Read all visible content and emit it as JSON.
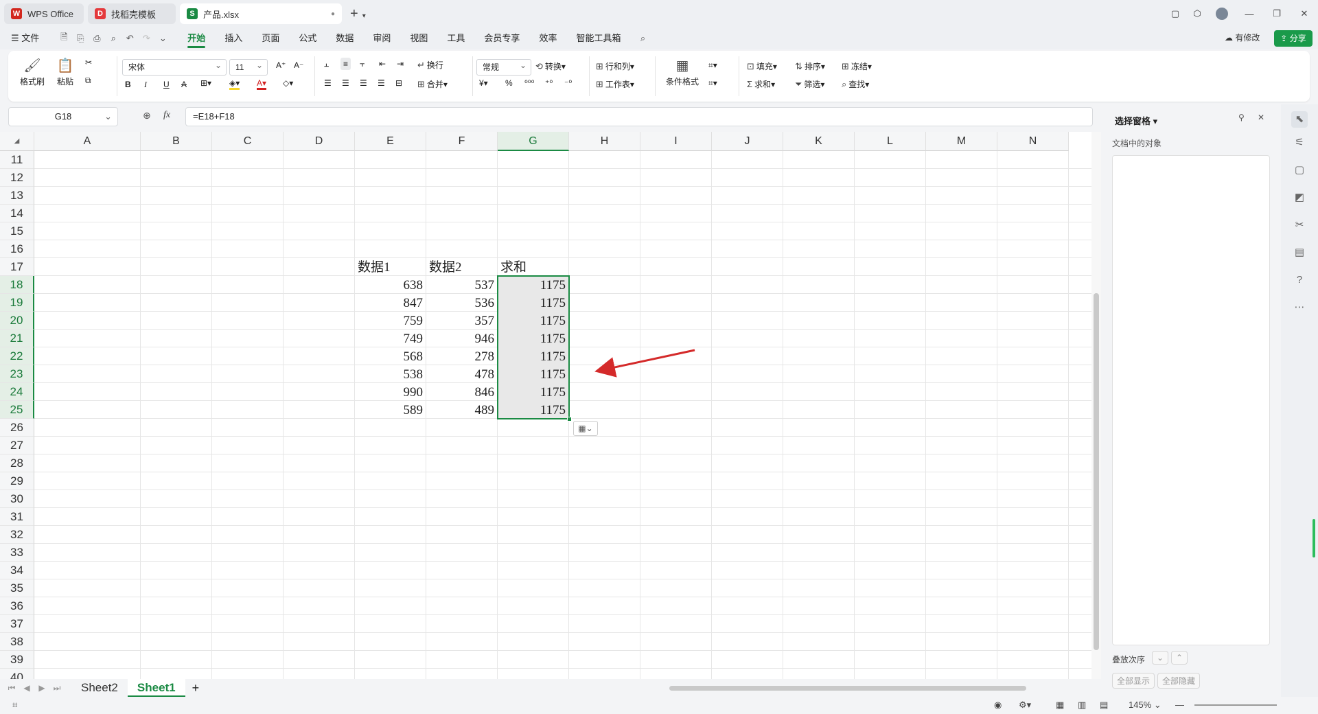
{
  "titlebar": {
    "tabs": [
      {
        "label": "WPS Office",
        "icon": "wps-logo-icon",
        "color": "#d2271e"
      },
      {
        "label": "找稻壳模板",
        "icon": "docer-logo-icon",
        "color": "#e4393c"
      },
      {
        "label": "产品.xlsx",
        "icon": "spreadsheet-logo-icon",
        "color": "#1a8a43",
        "active": true
      }
    ],
    "new_tab": "+"
  },
  "menubar": {
    "file": "文件",
    "items": [
      "开始",
      "插入",
      "页面",
      "公式",
      "数据",
      "审阅",
      "视图",
      "工具",
      "会员专享",
      "效率",
      "智能工具箱"
    ],
    "active": "开始",
    "modified_label": "有修改",
    "share_label": "分享"
  },
  "ribbon": {
    "format_painter": "格式刷",
    "paste": "粘贴",
    "font_name": "宋体",
    "font_size": "11",
    "wrap": "换行",
    "merge": "合并",
    "number_format": "常规",
    "convert": "转换",
    "row_col": "行和列",
    "worksheet": "工作表",
    "cond_format": "条件格式",
    "fill": "填充",
    "sort": "排序",
    "freeze": "冻结",
    "sum": "求和",
    "filter": "筛选",
    "find": "查找",
    "bold": "B",
    "italic": "I",
    "underline": "U",
    "percent": "%"
  },
  "formula": {
    "name_box": "G18",
    "fx": "fx",
    "formula": "=E18+F18"
  },
  "grid": {
    "columns": [
      "A",
      "B",
      "C",
      "D",
      "E",
      "F",
      "G",
      "H",
      "I",
      "J",
      "K",
      "L",
      "M",
      "N"
    ],
    "selected_column": "G",
    "rows": [
      "11",
      "12",
      "13",
      "14",
      "15",
      "16",
      "17",
      "18",
      "19",
      "20",
      "21",
      "22",
      "23",
      "24",
      "25",
      "26",
      "27",
      "28",
      "29",
      "30",
      "31",
      "32",
      "33",
      "34",
      "35",
      "36",
      "37",
      "38",
      "39",
      "40"
    ],
    "selected_rows": [
      "18",
      "19",
      "20",
      "21",
      "22",
      "23",
      "24",
      "25"
    ],
    "headers": [
      "数据1",
      "数据2",
      "求和"
    ],
    "data": [
      [
        "638",
        "537",
        "1175"
      ],
      [
        "847",
        "536",
        "1175"
      ],
      [
        "759",
        "357",
        "1175"
      ],
      [
        "749",
        "946",
        "1175"
      ],
      [
        "568",
        "278",
        "1175"
      ],
      [
        "538",
        "478",
        "1175"
      ],
      [
        "990",
        "846",
        "1175"
      ],
      [
        "589",
        "489",
        "1175"
      ]
    ],
    "selection_color": "#1a8a43",
    "arrow_color": "#d42a2a"
  },
  "sheets": {
    "tabs": [
      "Sheet2",
      "Sheet1"
    ],
    "active": "Sheet1",
    "add": "+"
  },
  "status": {
    "zoom": "145%"
  },
  "sidepanel": {
    "title": "选择窗格",
    "subtitle": "文档中的对象",
    "order_label": "叠放次序",
    "show_all": "全部显示",
    "hide_all": "全部隐藏"
  }
}
